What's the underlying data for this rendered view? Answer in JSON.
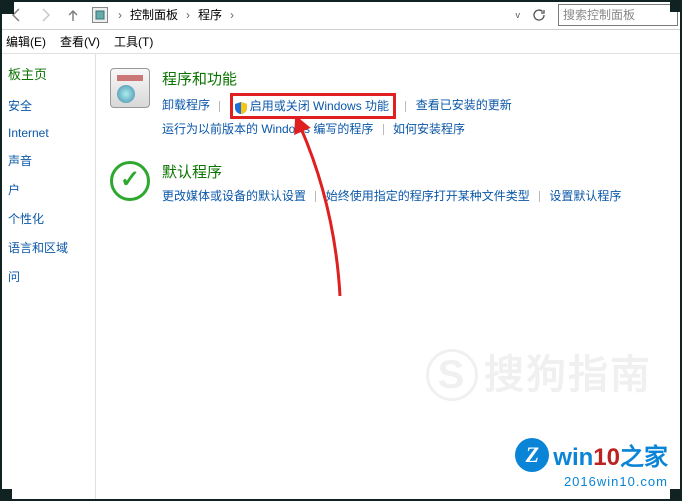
{
  "addressbar": {
    "back_label": "返回",
    "forward_label": "前进",
    "up_label": "上一级",
    "crumb1": "控制面板",
    "crumb2": "程序",
    "refresh_label": "刷新",
    "search_placeholder": "搜索控制面板"
  },
  "menubar": {
    "edit": "编辑(E)",
    "view": "查看(V)",
    "tools": "工具(T)"
  },
  "sidebar": {
    "title": "板主页",
    "items": [
      {
        "label": "安全"
      },
      {
        "label": "Internet"
      },
      {
        "label": "声音"
      },
      {
        "label": "户"
      },
      {
        "label": "个性化"
      },
      {
        "label": "语言和区域"
      },
      {
        "label": "问"
      }
    ]
  },
  "main": {
    "programs": {
      "title": "程序和功能",
      "uninstall": "卸载程序",
      "turn_features": "启用或关闭 Windows 功能",
      "view_updates": "查看已安装的更新",
      "run_previous": "运行为以前版本的 Windows 编写的程序",
      "how_install": "如何安装程序"
    },
    "defaults": {
      "title": "默认程序",
      "change_media": "更改媒体或设备的默认设置",
      "always_open": "始终使用指定的程序打开某种文件类型",
      "set_default": "设置默认程序"
    }
  },
  "watermark": {
    "text": "搜狗指南",
    "s": "S"
  },
  "logo": {
    "z": "Z",
    "text_win": "win",
    "text_num": "10",
    "text_suffix": "之家",
    "url": "2016win10.com"
  }
}
